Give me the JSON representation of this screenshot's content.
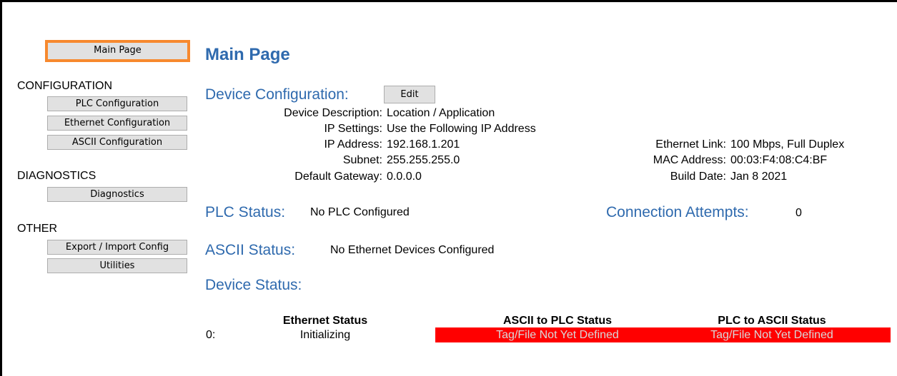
{
  "nav": {
    "main_page": "Main Page",
    "sections": [
      {
        "title": "CONFIGURATION",
        "items": [
          "PLC Configuration",
          "Ethernet Configuration",
          "ASCII Configuration"
        ]
      },
      {
        "title": "DIAGNOSTICS",
        "items": [
          "Diagnostics"
        ]
      },
      {
        "title": "OTHER",
        "items": [
          "Export / Import Config",
          "Utilities"
        ]
      }
    ]
  },
  "page": {
    "title": "Main Page"
  },
  "device_config": {
    "heading": "Device Configuration:",
    "edit_label": "Edit",
    "fields": [
      {
        "label": "Device Description:",
        "value": "Location / Application"
      },
      {
        "label": "IP Settings:",
        "value": "Use the Following IP Address"
      },
      {
        "label": "IP Address:",
        "value": "192.168.1.201"
      },
      {
        "label": "Subnet:",
        "value": "255.255.255.0"
      },
      {
        "label": "Default Gateway:",
        "value": "0.0.0.0"
      }
    ],
    "right_fields": [
      {
        "label": "Ethernet Link:",
        "value": "100 Mbps, Full Duplex"
      },
      {
        "label": "MAC Address:",
        "value": "00:03:F4:08:C4:BF"
      },
      {
        "label": "Build Date:",
        "value": "Jan 8 2021"
      }
    ]
  },
  "plc_status": {
    "heading": "PLC Status:",
    "value": "No PLC Configured"
  },
  "connection_attempts": {
    "heading": "Connection Attempts:",
    "value": "0"
  },
  "ascii_status": {
    "heading": "ASCII Status:",
    "value": "No Ethernet Devices Configured"
  },
  "device_status": {
    "heading": "Device Status:",
    "columns": [
      "Ethernet Status",
      "ASCII to PLC Status",
      "PLC to ASCII Status"
    ],
    "rows": [
      {
        "index": "0:",
        "ethernet": "Initializing",
        "ascii_to_plc": "Tag/File Not Yet Defined",
        "plc_to_ascii": "Tag/File Not Yet Defined"
      }
    ]
  },
  "colors": {
    "heading": "#2f6aae",
    "active_nav_border": "#f7892e",
    "error_bg": "#ff0000"
  }
}
